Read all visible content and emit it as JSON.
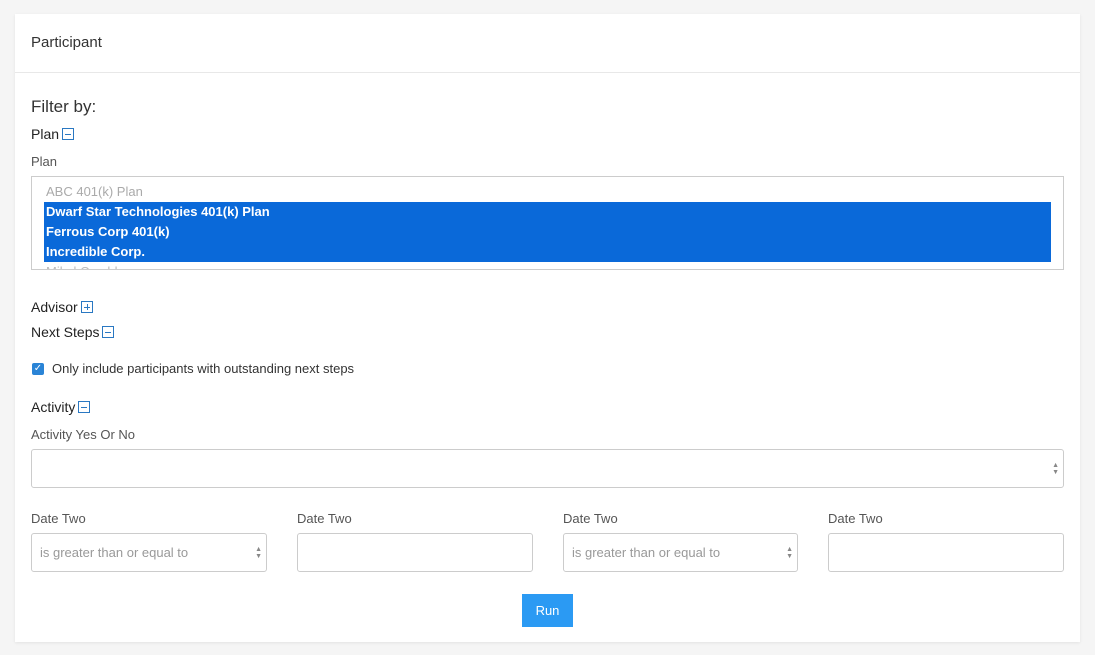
{
  "card": {
    "title": "Participant"
  },
  "filter": {
    "title": "Filter by:"
  },
  "plan": {
    "toggle_label": "Plan",
    "field_label": "Plan",
    "options": [
      {
        "label": "ABC 401(k) Plan",
        "selected": false
      },
      {
        "label": "Dwarf Star Technologies 401(k) Plan",
        "selected": true
      },
      {
        "label": "Ferrous Corp 401(k)",
        "selected": true
      },
      {
        "label": "Incredible Corp.",
        "selected": true
      },
      {
        "label": "Mikel Corchl...",
        "selected": false
      }
    ]
  },
  "advisor": {
    "toggle_label": "Advisor"
  },
  "next_steps": {
    "toggle_label": "Next Steps",
    "checkbox_label": "Only include participants with outstanding next steps",
    "checked": true
  },
  "activity": {
    "toggle_label": "Activity",
    "field_label": "Activity Yes Or No",
    "value": ""
  },
  "dates": [
    {
      "label": "Date Two",
      "type": "select",
      "value": "is greater than or equal to"
    },
    {
      "label": "Date Two",
      "type": "input",
      "value": ""
    },
    {
      "label": "Date Two",
      "type": "select",
      "value": "is greater than or equal to"
    },
    {
      "label": "Date Two",
      "type": "input",
      "value": ""
    }
  ],
  "run_button": {
    "label": "Run"
  },
  "colors": {
    "selection": "#0a69d9",
    "accent": "#2b9af3",
    "toggle": "#2a78c2"
  }
}
